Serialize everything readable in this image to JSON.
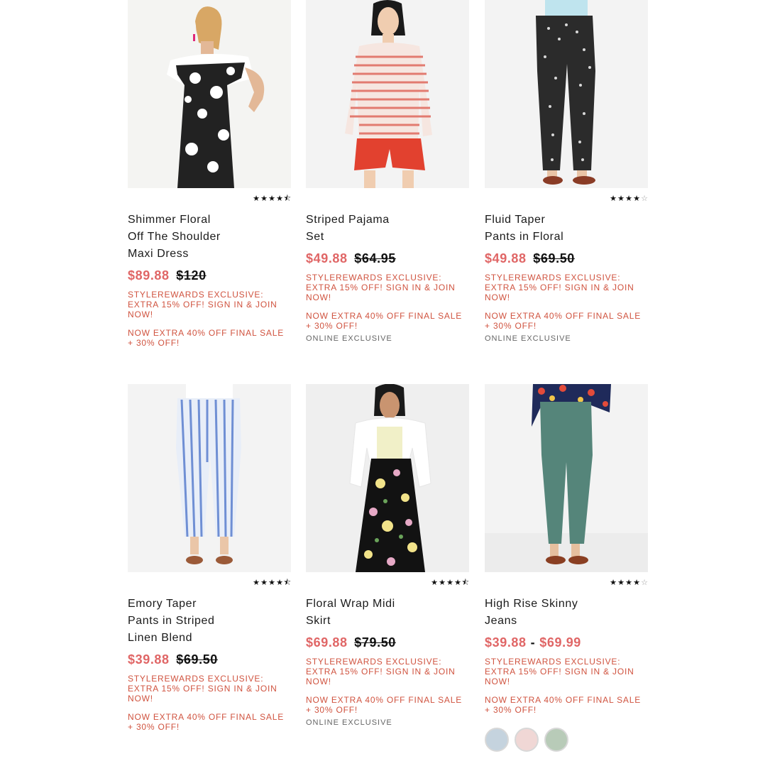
{
  "products": [
    {
      "name": "Shimmer Floral Off The Shoulder Maxi Dress",
      "name_lines": [
        "Shimmer Floral",
        "Off The Shoulder",
        "Maxi Dress"
      ],
      "sale_price": "$89.88",
      "original_price": "$120",
      "rating": 4.5,
      "promo1": "STYLEREWARDS EXCLUSIVE: EXTRA 15% OFF! SIGN IN & JOIN NOW!",
      "promo2": "NOW EXTRA 40% OFF FINAL SALE + 30% OFF!",
      "image_icon": "dress-photo"
    },
    {
      "name": "Striped Pajama Set",
      "name_lines": [
        "Striped Pajama",
        "Set"
      ],
      "sale_price": "$49.88",
      "original_price": "$64.95",
      "promo1": "STYLEREWARDS EXCLUSIVE: EXTRA 15% OFF! SIGN IN & JOIN NOW!",
      "promo2": "NOW EXTRA 40% OFF FINAL SALE + 30% OFF!",
      "online": "ONLINE EXCLUSIVE",
      "image_icon": "pajama-photo"
    },
    {
      "name": "Fluid Taper Pants in Floral",
      "name_lines": [
        "Fluid Taper",
        "Pants in Floral"
      ],
      "sale_price": "$49.88",
      "original_price": "$69.50",
      "rating": 4,
      "promo1": "STYLEREWARDS EXCLUSIVE: EXTRA 15% OFF! SIGN IN & JOIN NOW!",
      "promo2": "NOW EXTRA 40% OFF FINAL SALE + 30% OFF!",
      "online": "ONLINE EXCLUSIVE",
      "image_icon": "pants-photo"
    },
    {
      "name": "Emory Taper Pants in Striped Linen Blend",
      "name_lines": [
        "Emory Taper",
        "Pants in Striped",
        "Linen Blend"
      ],
      "sale_price": "$39.88",
      "original_price": "$69.50",
      "rating": 4.5,
      "promo1": "STYLEREWARDS EXCLUSIVE: EXTRA 15% OFF! SIGN IN & JOIN NOW!",
      "promo2": "NOW EXTRA 40% OFF FINAL SALE + 30% OFF!",
      "image_icon": "pants-photo"
    },
    {
      "name": "Floral Wrap Midi Skirt",
      "name_lines": [
        "Floral Wrap Midi",
        "Skirt"
      ],
      "sale_price": "$69.88",
      "original_price": "$79.50",
      "rating": 4.5,
      "promo1": "STYLEREWARDS EXCLUSIVE: EXTRA 15% OFF! SIGN IN & JOIN NOW!",
      "promo2": "NOW EXTRA 40% OFF FINAL SALE + 30% OFF!",
      "online": "ONLINE EXCLUSIVE",
      "image_icon": "skirt-photo"
    },
    {
      "name": "High Rise Skinny Jeans",
      "name_lines": [
        "High Rise Skinny",
        "Jeans"
      ],
      "sale_price": "$39.88",
      "price_range_sep": "-",
      "price_high": "$69.99",
      "rating": 4,
      "promo1": "STYLEREWARDS EXCLUSIVE: EXTRA 15% OFF! SIGN IN & JOIN NOW!",
      "promo2": "NOW EXTRA 40% OFF FINAL SALE + 30% OFF!",
      "swatches": [
        "#c5d3de",
        "#f0d7d5",
        "#b8cbb8"
      ],
      "image_icon": "jeans-photo"
    }
  ],
  "colors": {
    "sale": "#e06666",
    "promo": "#d0533f"
  }
}
